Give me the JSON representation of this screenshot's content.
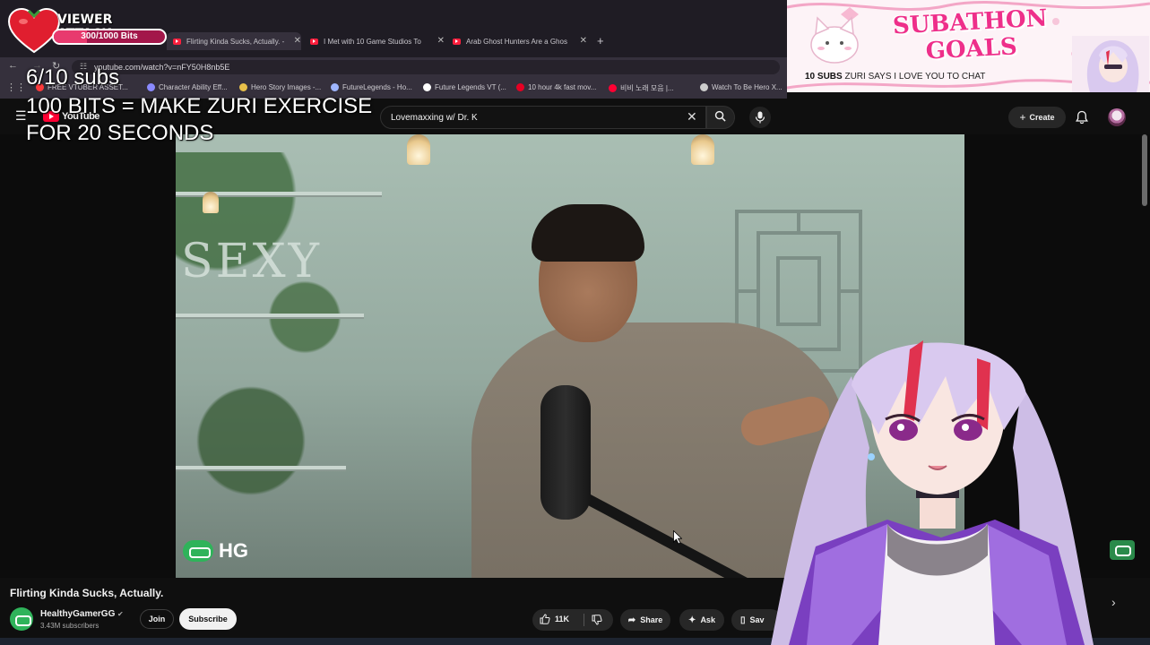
{
  "browser": {
    "tabs": [
      {
        "label": "Flirting Kinda Sucks, Actually. -",
        "active": true
      },
      {
        "label": "I Met with 10 Game Studios To",
        "active": false
      },
      {
        "label": "Arab Ghost Hunters Are a Ghos",
        "active": false
      }
    ],
    "new_tab": "+",
    "url": "youtube.com/watch?v=nFY50H8nb5E",
    "bookmarks": [
      {
        "label": "FREE VTUBER ASSET...",
        "color": "#ff3b3b"
      },
      {
        "label": "Character Ability Eff...",
        "color": "#8a8aff"
      },
      {
        "label": "Hero Story Images -...",
        "color": "#e8c04a"
      },
      {
        "label": "FutureLegends - Ho...",
        "color": "#9fb6ff"
      },
      {
        "label": "Future Legends VT (...",
        "color": "#ffffff"
      },
      {
        "label": "10 hour 4k fast mov...",
        "color": "#e60023"
      },
      {
        "label": "비비 노래 모음 |...",
        "color": "#ff0033"
      },
      {
        "label": "Watch To Be Hero X...",
        "color": "#cccccc"
      }
    ]
  },
  "masthead": {
    "logo_text": "YouTube",
    "search_query": "Lovemaxxing w/ Dr. K",
    "create_label": "Create"
  },
  "video": {
    "wall_text": "SEXY",
    "watermark": "HG"
  },
  "info": {
    "title": "Flirting Kinda Sucks, Actually.",
    "channel": "HealthyGamerGG",
    "subscribers": "3.43M subscribers",
    "join_label": "Join",
    "subscribe_label": "Subscribe",
    "likes": "11K",
    "share_label": "Share",
    "ask_label": "Ask",
    "save_label": "Sav"
  },
  "overlay": {
    "viewer_attack_title": "VIEWER ATTACK",
    "viewer_attack_bits": "300/1000 Bits",
    "viewer_attack_progress": 0.3,
    "subs_counter": "6/10 subs",
    "bits_goal_line1": "100 BITS = MAKE ZURI EXERCISE",
    "bits_goal_line2": "FOR 20 SECONDS",
    "subathon_title_line1": "SUBATHON",
    "subathon_title_line2": "GOALS",
    "subathon_goal_count": "10 SUBS",
    "subathon_goal_text": "ZURI SAYS I LOVE YOU TO CHAT"
  },
  "colors": {
    "youtube_red": "#ff0033",
    "hg_green": "#2fb35a",
    "subathon_pink": "#ee2f8a",
    "viewer_attack_bar": "#a3174a"
  },
  "icons": [
    "menu-icon",
    "search-icon",
    "mic-icon",
    "close-icon",
    "bell-icon",
    "like-icon",
    "dislike-icon",
    "share-icon",
    "ask-icon",
    "save-icon",
    "chevron-right-icon",
    "heart-icon",
    "verified-icon"
  ]
}
